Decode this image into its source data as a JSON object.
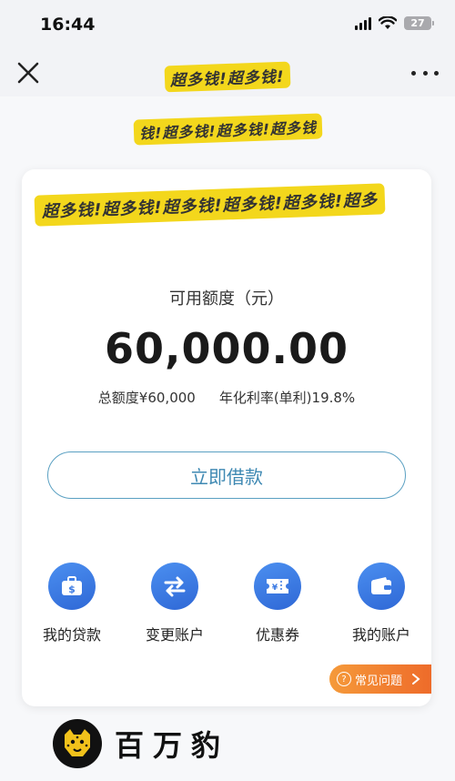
{
  "status_bar": {
    "time": "16:44",
    "battery": "27"
  },
  "nav": {
    "title": "超多钱!超多钱!"
  },
  "page": {
    "subtitle": "钱!超多钱!超多钱!超多钱",
    "card_header": "超多钱!超多钱!超多钱!超多钱!超多钱!超多",
    "limit_label": "可用额度（元）",
    "limit_amount": "60,000.00",
    "total_limit": "总额度¥60,000",
    "rate": "年化利率(单利)19.8%",
    "borrow_button": "立即借款",
    "menu": [
      {
        "label": "我的贷款",
        "icon": "loan-wallet-icon"
      },
      {
        "label": "变更账户",
        "icon": "switch-arrows-icon"
      },
      {
        "label": "优惠券",
        "icon": "coupon-icon"
      },
      {
        "label": "我的账户",
        "icon": "account-wallet-icon"
      }
    ],
    "faq": "常见问题",
    "brand_name": "百万豹"
  },
  "colors": {
    "accent_blue": "#3f89b3",
    "icon_blue": "#3b7ae3",
    "faq_orange": "#ee6b2a",
    "highlight_yellow": "#f3d71c"
  }
}
